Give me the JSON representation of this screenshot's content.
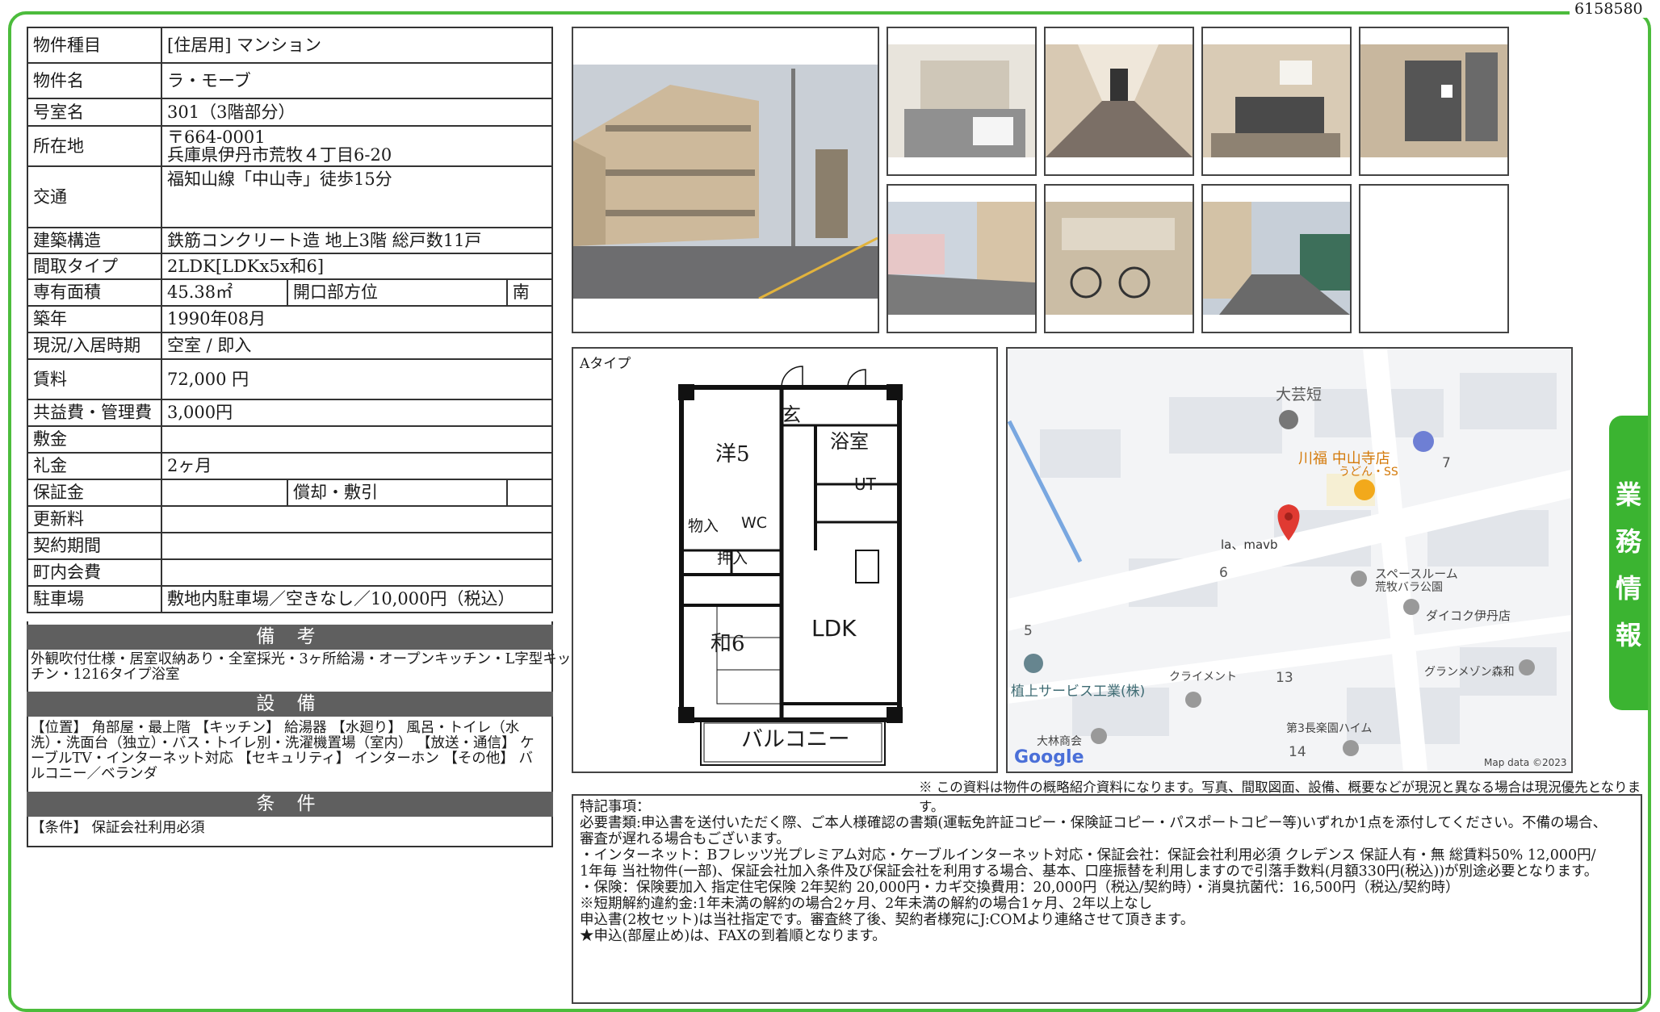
{
  "property_id": "6158580",
  "side_tab": [
    "業",
    "務",
    "情",
    "報"
  ],
  "info": {
    "type_label": "物件種目",
    "type_value": "[住居用]  マンション",
    "name_label": "物件名",
    "name_value": "ラ・モーブ",
    "room_label": "号室名",
    "room_value": "301（3階部分）",
    "address_label": "所在地",
    "postal": "〒664-0001",
    "address_value": "兵庫県伊丹市荒牧４丁目6-20",
    "transport_label": "交通",
    "transport_value": "福知山線「中山寺」徒歩15分",
    "structure_label": "建築構造",
    "structure_value": "鉄筋コンクリート造  地上3階  総戸数11戸",
    "layout_label": "間取タイプ",
    "layout_value": "2LDK[LDKx5x和6]",
    "area_label": "専有面積",
    "area_value": "45.38㎡",
    "direction_label": "開口部方位",
    "direction_value": "南",
    "built_label": "築年",
    "built_value": "1990年08月",
    "status_label": "現況/入居時期",
    "status_value": "空室 / 即入",
    "rent_label": "賃料",
    "rent_value": "72,000 円",
    "fee_label": "共益費・管理費",
    "fee_value": "3,000円",
    "deposit_label": "敷金",
    "deposit_value": "",
    "key_money_label": "礼金",
    "key_money_value": "2ヶ月",
    "guarantee_label": "保証金",
    "guarantee_value": "",
    "amort_label": "償却・敷引",
    "amort_value": "",
    "renewal_label": "更新料",
    "renewal_value": "",
    "contract_label": "契約期間",
    "contract_value": "",
    "community_label": "町内会費",
    "community_value": "",
    "parking_label": "駐車場",
    "parking_value": "敷地内駐車場／空きなし／10,000円（税込）"
  },
  "remarks": {
    "heading": "備 考",
    "text": "外観吹付仕様・居室収納あり・全室採光・3ヶ所給湯・オープンキッチン・L字型キッチン・1216タイプ浴室"
  },
  "equipment": {
    "heading": "設 備",
    "text": "【位置】 角部屋・最上階 【キッチン】 給湯器 【水廻り】 風呂・トイレ（水洗）・洗面台（独立）・バス・トイレ別・洗濯機置場（室内） 【放送・通信】 ケーブルTV・インターネット対応 【セキュリティ】 インターホン 【その他】 バルコニー／ベランダ"
  },
  "conditions": {
    "heading": "条 件",
    "text": "【条件】 保証会社利用必須"
  },
  "floorplan": {
    "type_label": "Aタイプ",
    "rooms": {
      "genkan": "玄",
      "yo5": "洋5",
      "bath": "浴室",
      "ut": "UT",
      "mono": "物入",
      "wc": "WC",
      "oshiire": "押入",
      "wa6": "和6",
      "ldk": "LDK",
      "balcony": "バルコニー"
    }
  },
  "map": {
    "labels": {
      "school": "大芸短",
      "restaurant": "川福 中山寺店",
      "restaurant_sub": "うどん・SS",
      "property": "la、mavb",
      "storage": "スペースルーム",
      "storage_sub": "荒牧バラ公園",
      "daikoku": "ダイコク伊丹店",
      "n5": "5",
      "n6": "6",
      "n7": "7",
      "n13": "13",
      "n14": "14",
      "company": "植上サービス工業(株)",
      "climent": "クライメント",
      "maison": "グランメゾン森和",
      "haim": "第3長楽園ハイム",
      "obayashi": "大林商会",
      "google": "Google",
      "mapdata": "Map data ©2023"
    }
  },
  "disclaimer": "※ この資料は物件の概略紹介資料になります。写真、間取図面、設備、概要などが現況と異なる場合は現況優先となります。",
  "notes": [
    "特記事項：",
    "必要書類:申込書を送付いただく際、ご本人様確認の書類(運転免許証コピー・保険証コピー・パスポートコピー等)いずれか1点を添付してください。不備の場合、",
    "審査が遅れる場合もございます。",
    "・インターネット：Bフレッツ光プレミアム対応・ケーブルインターネット対応・保証会社：保証会社利用必須 クレデンス 保証人有・無 総賃料50% 12,000円/",
    "1年毎 当社物件(一部)、保証会社加入条件及び保証会社を利用する場合、基本、口座振替を利用しますので引落手数料(月額330円(税込))が別途必要となります。",
    "・保険：保険要加入 指定住宅保険 2年契約 20,000円・カギ交換費用：20,000円（税込/契約時）・消臭抗菌代：16,500円（税込/契約時）",
    "※短期解約違約金:1年未満の解約の場合2ヶ月、2年未満の解約の場合1ヶ月、2年以上なし",
    "申込書(2枚セット)は当社指定です。審査終了後、契約者様宛にJ:COMより連絡させて頂きます。",
    "★申込(部屋止め)は、FAXの到着順となります。"
  ]
}
